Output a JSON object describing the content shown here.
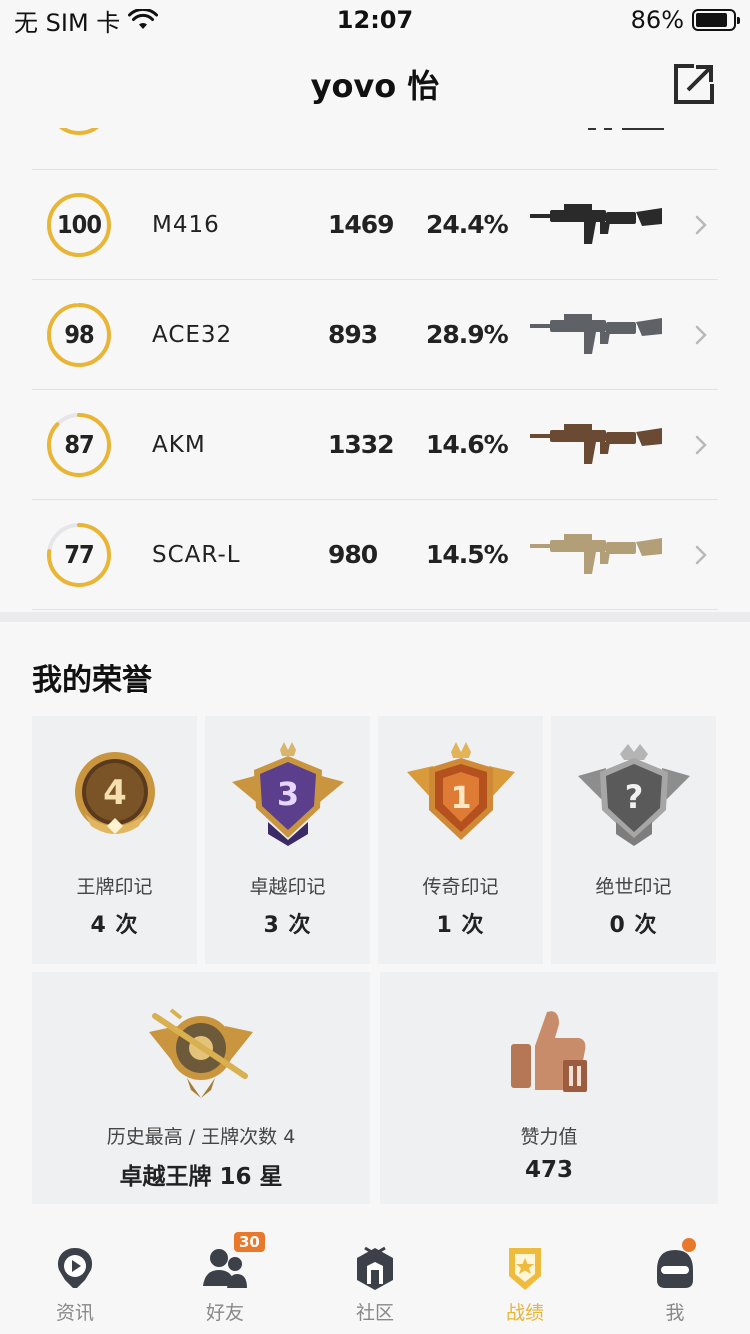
{
  "status_bar": {
    "carrier": "无 SIM 卡",
    "time": "12:07",
    "battery": "86%",
    "battery_level": 0.86
  },
  "nav": {
    "title": "yovo 怡"
  },
  "weapons": [
    {
      "score": "100",
      "score_fraction": 1.0,
      "name": "M416",
      "kills": "1469",
      "rate": "24.4%",
      "color": "#2a2a2a"
    },
    {
      "score": "98",
      "score_fraction": 0.98,
      "name": "ACE32",
      "kills": "893",
      "rate": "28.9%",
      "color": "#5e6166"
    },
    {
      "score": "87",
      "score_fraction": 0.87,
      "name": "AKM",
      "kills": "1332",
      "rate": "14.6%",
      "color": "#6b4a34"
    },
    {
      "score": "77",
      "score_fraction": 0.77,
      "name": "SCAR-L",
      "kills": "980",
      "rate": "14.5%",
      "color": "#b29f78"
    }
  ],
  "honors": {
    "title": "我的荣誉",
    "marks": [
      {
        "label": "王牌印记",
        "count": "4 次",
        "badge_text": "4"
      },
      {
        "label": "卓越印记",
        "count": "3 次",
        "badge_text": "3"
      },
      {
        "label": "传奇印记",
        "count": "1 次",
        "badge_text": "1"
      },
      {
        "label": "绝世印记",
        "count": "0 次",
        "badge_text": "?"
      }
    ],
    "history": {
      "label": "历史最高 / 王牌次数 4",
      "value": "卓越王牌 16 星"
    },
    "likes": {
      "label": "赞力值",
      "value": "473"
    }
  },
  "tabs": [
    {
      "label": "资讯",
      "icon": "news-icon",
      "active": false
    },
    {
      "label": "好友",
      "icon": "friends-icon",
      "active": false,
      "badge": "30"
    },
    {
      "label": "社区",
      "icon": "community-icon",
      "active": false
    },
    {
      "label": "战绩",
      "icon": "record-icon",
      "active": true
    },
    {
      "label": "我",
      "icon": "profile-icon",
      "active": false
    }
  ],
  "colors": {
    "accent": "#e8b535",
    "badge_orange": "#e8792c"
  }
}
